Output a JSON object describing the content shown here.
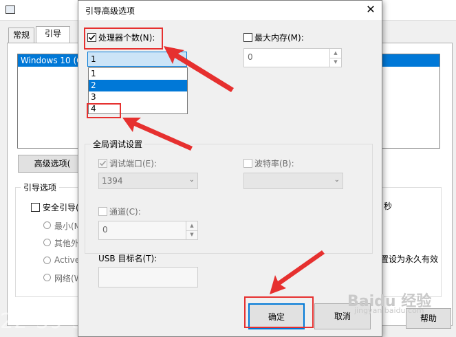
{
  "background_window": {
    "tabs": [
      "常规",
      "引导"
    ],
    "boot_list_item": "Windows 10 (C",
    "advanced_button": "高级选项(",
    "boot_options_label": "引导选项",
    "safe_boot_label": "安全引导(",
    "radio_options": [
      "最小(M",
      "其他外",
      "Active",
      "网络(W"
    ],
    "seconds_fragment": "秒",
    "permanent_fragment": "置设为永久有效",
    "help_button": "帮助",
    "watermark": "22-39-34-279"
  },
  "dialog": {
    "title": "引导高级选项",
    "close_glyph": "✕",
    "num_processors": {
      "label": "处理器个数(N):",
      "checked": true,
      "value": "1",
      "options": [
        "1",
        "2",
        "3",
        "4"
      ],
      "selected_option": "2"
    },
    "max_memory": {
      "label": "最大内存(M):",
      "checked": false,
      "value": "0"
    },
    "global_debug": {
      "title": "全局调试设置",
      "debug_port": {
        "label": "调试端口(E):",
        "checked": true,
        "value": "1394"
      },
      "baud_rate": {
        "label": "波特率(B):",
        "checked": false,
        "value": ""
      },
      "channel": {
        "label": "通道(C):",
        "checked": false,
        "value": "0"
      },
      "usb_target": {
        "label": "USB 目标名(T):",
        "value": ""
      }
    },
    "ok_button": "确定",
    "cancel_button": "取消"
  },
  "brand_watermark": {
    "logo_text": "Baidu 经验",
    "sub_text": "jingyan.baidu.com"
  },
  "annotation_color": "#e6302f",
  "selection_color": "#0078d7"
}
